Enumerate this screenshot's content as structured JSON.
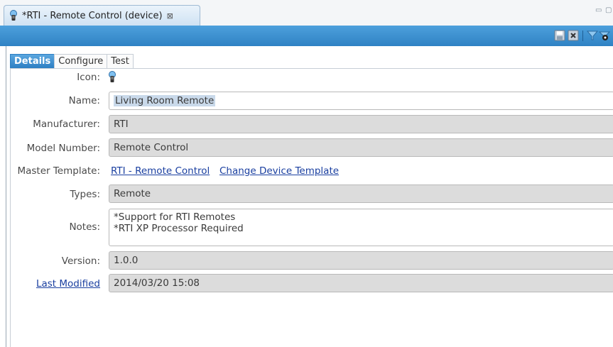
{
  "editor_tab": {
    "title": "*RTI - Remote Control (device)",
    "close_glyph": "⊠"
  },
  "toolbar": {
    "icons": [
      "save-icon",
      "delete-icon",
      "filter-icon",
      "preview-icon"
    ]
  },
  "subtabs": [
    "Details",
    "Configure",
    "Test"
  ],
  "active_subtab": "Details",
  "form": {
    "icon_label": "Icon:",
    "name_label": "Name:",
    "name_value": "Living Room Remote",
    "manufacturer_label": "Manufacturer:",
    "manufacturer_value": "RTI",
    "model_label": "Model Number:",
    "model_value": "Remote Control",
    "master_label": "Master Template:",
    "master_link": "RTI - Remote Control",
    "change_link": "Change Device Template",
    "types_label": "Types:",
    "types_value": "Remote",
    "notes_label": "Notes:",
    "notes_lines": [
      "*Support for RTI Remotes",
      "*RTI XP Processor Required"
    ],
    "version_label": "Version:",
    "version_value": "1.0.0",
    "last_modified_label": "Last Modified",
    "last_modified_value": "2014/03/20 15:08"
  },
  "colors": {
    "accent_band": "#3a8fd0",
    "active_tab": "#2d7fc3",
    "link": "#1a3fa0"
  }
}
